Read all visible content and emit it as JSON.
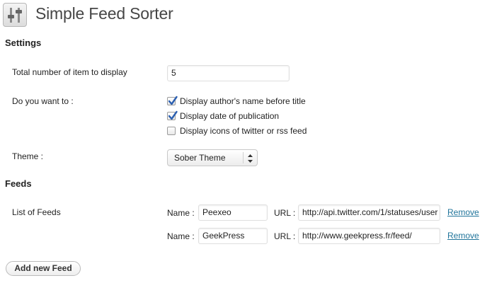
{
  "header": {
    "title": "Simple Feed Sorter",
    "icon": "sliders-icon"
  },
  "settings": {
    "section_title": "Settings",
    "total_label": "Total number of item to display",
    "total_value": "5",
    "options_label": "Do you want to :",
    "options": [
      {
        "label": "Display author's name before title",
        "checked": true
      },
      {
        "label": "Display date of publication",
        "checked": true
      },
      {
        "label": "Display icons of twitter or rss feed",
        "checked": false
      }
    ],
    "theme_label": "Theme :",
    "theme_value": "Sober Theme"
  },
  "feeds": {
    "section_title": "Feeds",
    "list_label": "List of Feeds",
    "name_label": "Name :",
    "url_label": "URL :",
    "remove_label": "Remove",
    "items": [
      {
        "name": "Peexeo",
        "url": "http://api.twitter.com/1/statuses/user"
      },
      {
        "name": "GeekPress",
        "url": "http://www.geekpress.fr/feed/"
      }
    ],
    "add_button": "Add new Feed"
  },
  "colors": {
    "link": "#21759b",
    "check": "#2b5fb0"
  }
}
